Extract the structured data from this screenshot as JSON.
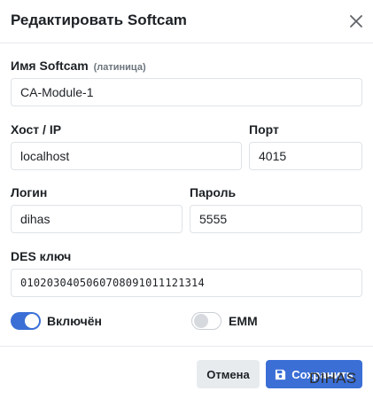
{
  "modal": {
    "title": "Редактировать Softcam",
    "close_icon": "close-icon"
  },
  "form": {
    "name": {
      "label": "Имя Softcam",
      "hint": "(латиница)",
      "value": "CA-Module-1"
    },
    "host": {
      "label": "Хост / IP",
      "value": "localhost"
    },
    "port": {
      "label": "Порт",
      "value": "4015"
    },
    "login": {
      "label": "Логин",
      "value": "dihas"
    },
    "password": {
      "label": "Пароль",
      "value": "5555"
    },
    "des_key": {
      "label": "DES ключ",
      "value": "0102030405060708091011121314"
    }
  },
  "toggles": {
    "enabled": {
      "label": "Включён",
      "state": true
    },
    "emm": {
      "label": "EMM",
      "state": false
    }
  },
  "footer": {
    "cancel_label": "Отмена",
    "save_label": "Сохранить",
    "save_icon": "floppy-disk-icon"
  },
  "watermark": "DIHAS",
  "colors": {
    "accent": "#3b6fd6",
    "cancel_bg": "#e8ebee",
    "border": "#dfe3e7"
  }
}
